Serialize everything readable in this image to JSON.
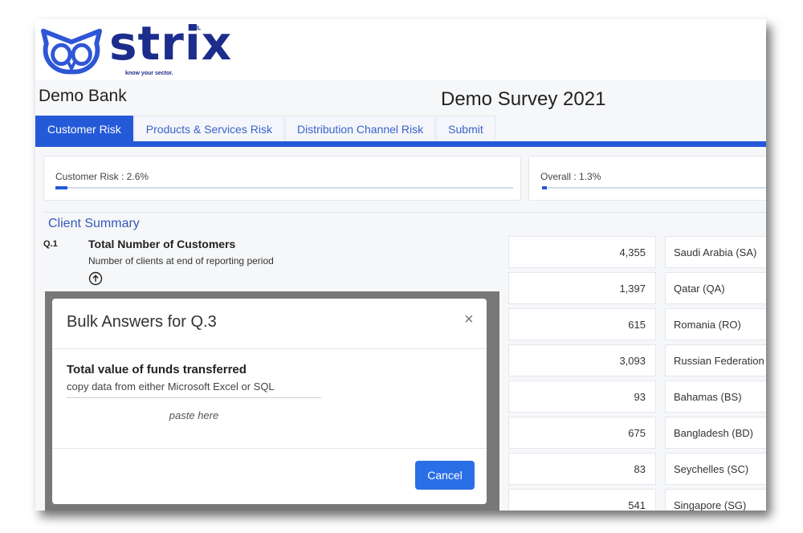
{
  "brand": {
    "name": "strix",
    "superscript": "AML",
    "tagline": "know your sector."
  },
  "header": {
    "bank": "Demo Bank",
    "survey": "Demo Survey 2021"
  },
  "tabs": [
    {
      "label": "Customer Risk",
      "active": true
    },
    {
      "label": "Products & Services Risk",
      "active": false
    },
    {
      "label": "Distribution Channel Risk",
      "active": false
    },
    {
      "label": "Submit",
      "active": false
    }
  ],
  "progress": {
    "customer_label": "Customer Risk : 2.6%",
    "customer_value": 0.026,
    "overall_label": "Overall : 1.3%",
    "overall_value": 0.013
  },
  "section": {
    "title": "Client Summary",
    "question": {
      "number": "Q.1",
      "title": "Total Number of Customers",
      "subtitle": "Number of clients at end of reporting period"
    }
  },
  "rows": [
    {
      "value": "4,355",
      "country": "Saudi Arabia (SA)"
    },
    {
      "value": "1,397",
      "country": "Qatar (QA)"
    },
    {
      "value": "615",
      "country": "Romania (RO)"
    },
    {
      "value": "3,093",
      "country": "Russian Federation"
    },
    {
      "value": "93",
      "country": "Bahamas (BS)"
    },
    {
      "value": "675",
      "country": "Bangladesh (BD)"
    },
    {
      "value": "83",
      "country": "Seychelles (SC)"
    },
    {
      "value": "541",
      "country": "Singapore (SG)"
    }
  ],
  "modal": {
    "title": "Bulk Answers for Q.3",
    "close": "×",
    "question_title": "Total value of funds transferred",
    "question_sub": "copy data  from either Microsoft Excel or SQL",
    "paste_placeholder": "paste here",
    "cancel_label": "Cancel"
  },
  "colors": {
    "accent": "#2459d8",
    "brand": "#1d2d8c",
    "button": "#2b6fe6"
  }
}
